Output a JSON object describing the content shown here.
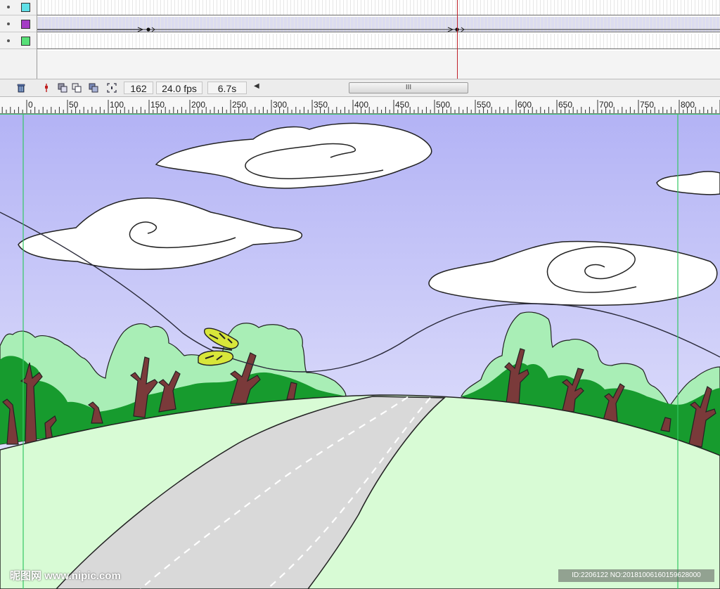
{
  "timeline": {
    "layers": [
      {
        "color": "#5ee0e8"
      },
      {
        "color": "#a43cc4"
      },
      {
        "color": "#58e078"
      }
    ],
    "current_frame": "162",
    "fps": "24.0 fps",
    "elapsed": "6.7s",
    "scroll_grip": "III"
  },
  "ruler": {
    "labels": [
      "0",
      "50",
      "100",
      "150",
      "200",
      "250",
      "300",
      "350",
      "400",
      "450",
      "500",
      "550",
      "600",
      "650",
      "700",
      "750",
      "800"
    ]
  },
  "watermark": {
    "left_text": "昵图网 www.nipic.com",
    "right_text": "ID:2206122 NO:20181006160159628000"
  },
  "colors": {
    "sky_top": "#b4b4f4",
    "sky_bottom": "#ececfc",
    "grass": "#d8fcd4",
    "road": "#d8d8d8",
    "tree_light": "#a8eeb4",
    "tree_dark": "#18a030",
    "trunk": "#7a3a3a",
    "guide": "#34c864"
  }
}
